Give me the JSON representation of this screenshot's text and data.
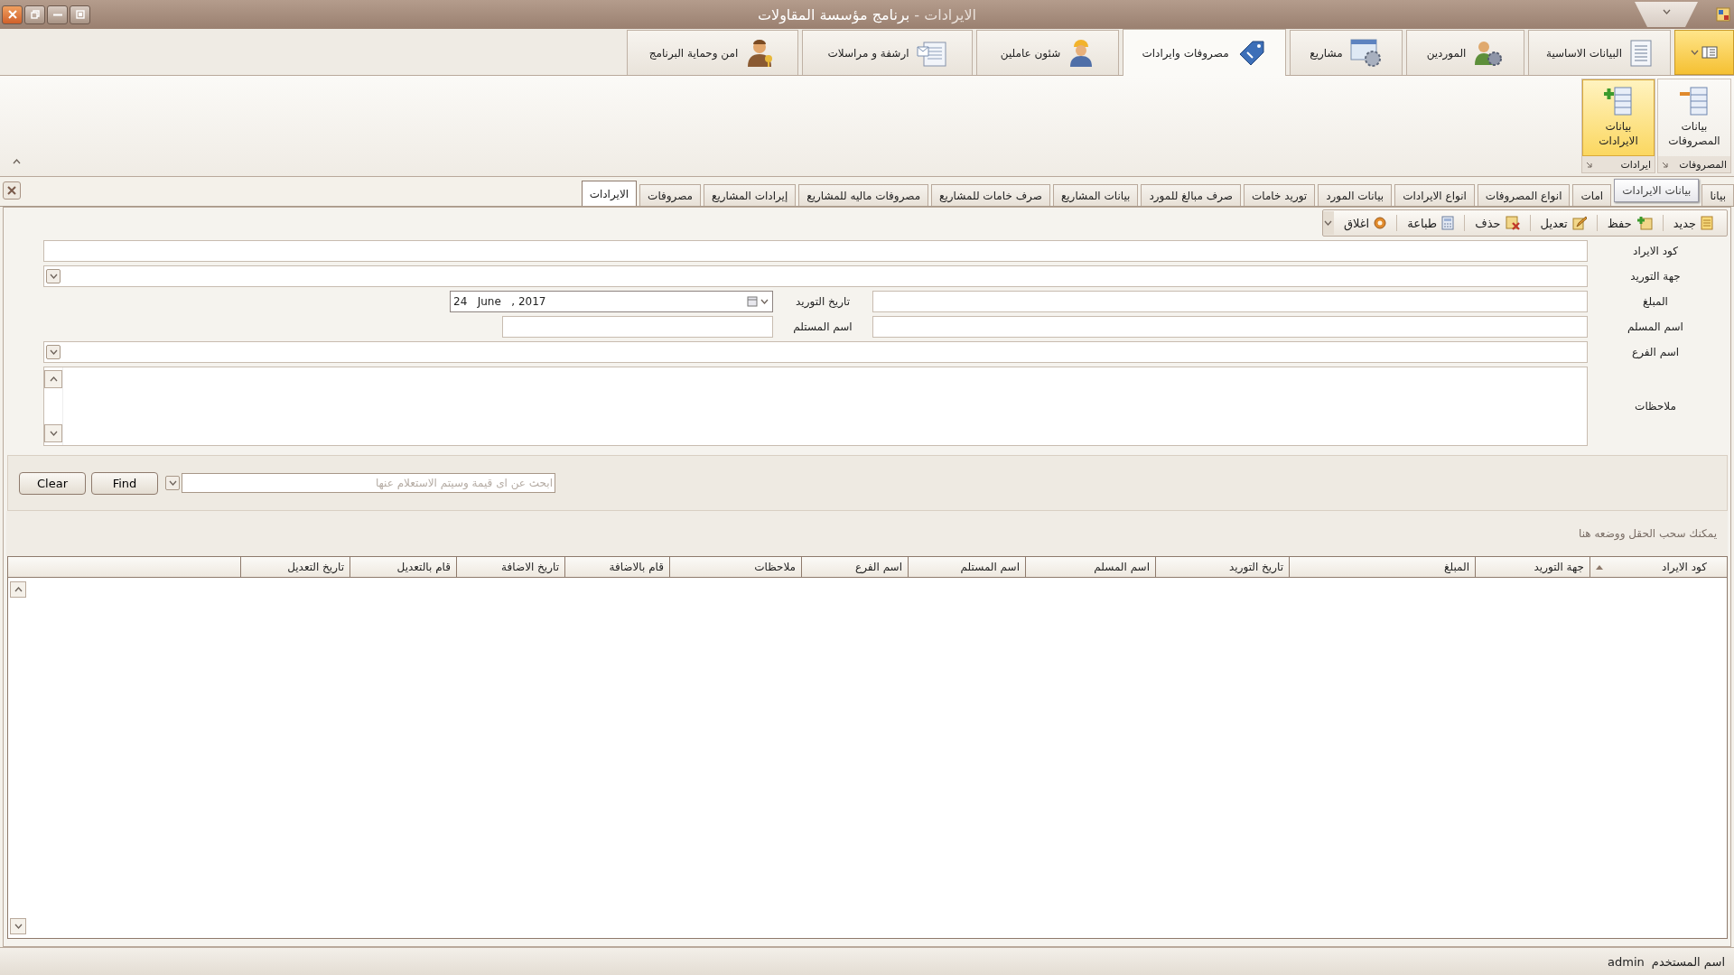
{
  "window": {
    "title_doc": "الايرادات -",
    "title_app": "برنامج مؤسسة المقاولات"
  },
  "ribbon_tabs": [
    {
      "label": "البيانات الاساسية",
      "selected": false
    },
    {
      "label": "الموردين",
      "selected": false
    },
    {
      "label": "مشاريع",
      "selected": false
    },
    {
      "label": "مصروفات وايرادات",
      "selected": true
    },
    {
      "label": "شئون عاملين",
      "selected": false
    },
    {
      "label": "ارشفة و مراسلات",
      "selected": false
    },
    {
      "label": "امن وحماية البرنامج",
      "selected": false
    }
  ],
  "ribbon_groups": [
    {
      "label": "المصروفات",
      "button": "بيانات المصروفات",
      "selected": false
    },
    {
      "label": "ايرادات",
      "button": "بيانات الايرادات",
      "selected": true
    }
  ],
  "doc_tabs": [
    {
      "label": "بيانا",
      "selected": false
    },
    {
      "kind": "tooltip",
      "label": "بيانات الايرادات"
    },
    {
      "label": "امات",
      "selected": false
    },
    {
      "label": "انواع المصروفات",
      "selected": false
    },
    {
      "label": "انواع الايرادات",
      "selected": false
    },
    {
      "label": "بيانات المورد",
      "selected": false
    },
    {
      "label": "توريد خامات",
      "selected": false
    },
    {
      "label": "صرف مبالغ للمورد",
      "selected": false
    },
    {
      "label": "بيانات المشاريع",
      "selected": false
    },
    {
      "label": "صرف خامات للمشاريع",
      "selected": false
    },
    {
      "label": "مصروفات ماليه للمشاريع",
      "selected": false
    },
    {
      "label": "إيرادات المشاريع",
      "selected": false
    },
    {
      "label": "مصروفات",
      "selected": false
    },
    {
      "label": "الايرادات",
      "selected": true
    }
  ],
  "toolbar": [
    "جديد",
    "حفظ",
    "تعديل",
    "حذف",
    "طباعة",
    "اغلاق"
  ],
  "form": {
    "code_label": "كود الايراد",
    "supplier_label": "جهة التوريد",
    "amount_label": "المبلغ",
    "date_label": "تاريخ التوريد",
    "date_value": "24   June   , 2017",
    "deliverer_label": "اسم المسلم",
    "receiver_label": "اسم المستلم",
    "branch_label": "اسم الفرع",
    "notes_label": "ملاحظات"
  },
  "search": {
    "clear": "Clear",
    "find": "Find",
    "placeholder": "ابحث عن اى قيمة وسيتم الاستعلام عنها"
  },
  "group_hint": "يمكنك سحب الحقل ووضعه هنا",
  "table": {
    "columns": [
      {
        "label": "كود الايراد",
        "sorted": true
      },
      {
        "label": "جهة التوريد",
        "sorted": false
      },
      {
        "label": "المبلغ",
        "sorted": false
      },
      {
        "label": "تاريخ التوريد",
        "sorted": false
      },
      {
        "label": "اسم المسلم",
        "sorted": false
      },
      {
        "label": "اسم المستلم",
        "sorted": false
      },
      {
        "label": "اسم الفرع",
        "sorted": false
      },
      {
        "label": "ملاحظات",
        "sorted": false
      },
      {
        "label": "قام بالاضافة",
        "sorted": false
      },
      {
        "label": "تاريخ الاضافة",
        "sorted": false
      },
      {
        "label": "قام بالتعديل",
        "sorted": false
      },
      {
        "label": "تاريخ التعديل",
        "sorted": false
      }
    ]
  },
  "status_bar": {
    "user_label": "اسم المستخدم",
    "user": "admin"
  }
}
